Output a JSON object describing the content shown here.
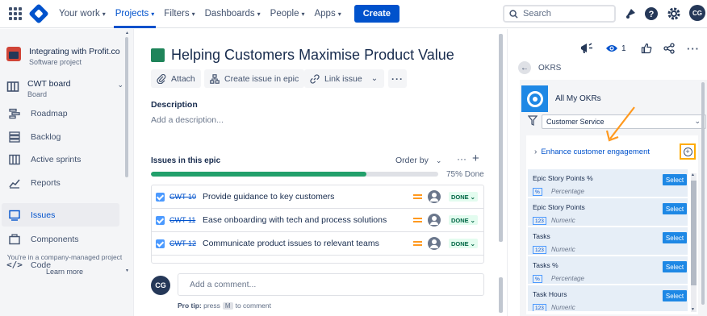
{
  "nav": {
    "items": [
      {
        "label": "Your work"
      },
      {
        "label": "Projects"
      },
      {
        "label": "Filters"
      },
      {
        "label": "Dashboards"
      },
      {
        "label": "People"
      },
      {
        "label": "Apps"
      }
    ],
    "create_label": "Create",
    "search_placeholder": "Search",
    "avatar_initials": "CG"
  },
  "sidebar": {
    "project_name": "Integrating with Profit.co",
    "project_type": "Software project",
    "board_name": "CWT board",
    "board_sub": "Board",
    "items": [
      {
        "label": "Roadmap"
      },
      {
        "label": "Backlog"
      },
      {
        "label": "Active sprints"
      },
      {
        "label": "Reports"
      },
      {
        "label": "Issues"
      },
      {
        "label": "Components"
      },
      {
        "label": "Code"
      }
    ],
    "footer_text": "You're in a company-managed project",
    "learn_more": "Learn more"
  },
  "issue": {
    "title": "Helping Customers Maximise Product Value",
    "buttons": {
      "attach": "Attach",
      "create_in_epic": "Create issue in epic",
      "link_issue": "Link issue"
    },
    "description_label": "Description",
    "description_placeholder": "Add a description...",
    "epic_header": "Issues in this epic",
    "order_by": "Order by",
    "progress_percent": 75,
    "progress_text": "75% Done",
    "children": [
      {
        "key": "CWT-10",
        "summary": "Provide guidance to key customers",
        "status": "DONE"
      },
      {
        "key": "CWT-11",
        "summary": "Ease onboarding with tech and process solutions",
        "status": "DONE"
      },
      {
        "key": "CWT-12",
        "summary": "Communicate product issues to relevant teams",
        "status": "DONE"
      }
    ],
    "comment_avatar": "CG",
    "comment_placeholder": "Add a comment...",
    "protip_prefix": "Pro tip:",
    "protip_press": "press",
    "protip_key": "M",
    "protip_suffix": "to comment"
  },
  "panel": {
    "watch_count": "1",
    "okrs_title": "OKRS",
    "app_title": "All My OKRs",
    "filter_value": "Customer Service",
    "objective": "Enhance customer engagement",
    "options": [
      {
        "name": "Epic Story Points %",
        "badge": "%",
        "type": "Percentage",
        "select": "Select"
      },
      {
        "name": "Epic Story Points",
        "badge": "123",
        "type": "Numeric",
        "select": "Select"
      },
      {
        "name": "Tasks",
        "badge": "123",
        "type": "Numeric",
        "select": "Select"
      },
      {
        "name": "Tasks %",
        "badge": "%",
        "type": "Percentage",
        "select": "Select"
      },
      {
        "name": "Task Hours",
        "badge": "123",
        "type": "Numeric",
        "select": "Select"
      }
    ]
  },
  "colors": {
    "brand": "#0052cc",
    "epic": "#1f845a",
    "progress": "#22a06b",
    "highlight": "#ffab00",
    "app_accent": "#1e88e5"
  }
}
